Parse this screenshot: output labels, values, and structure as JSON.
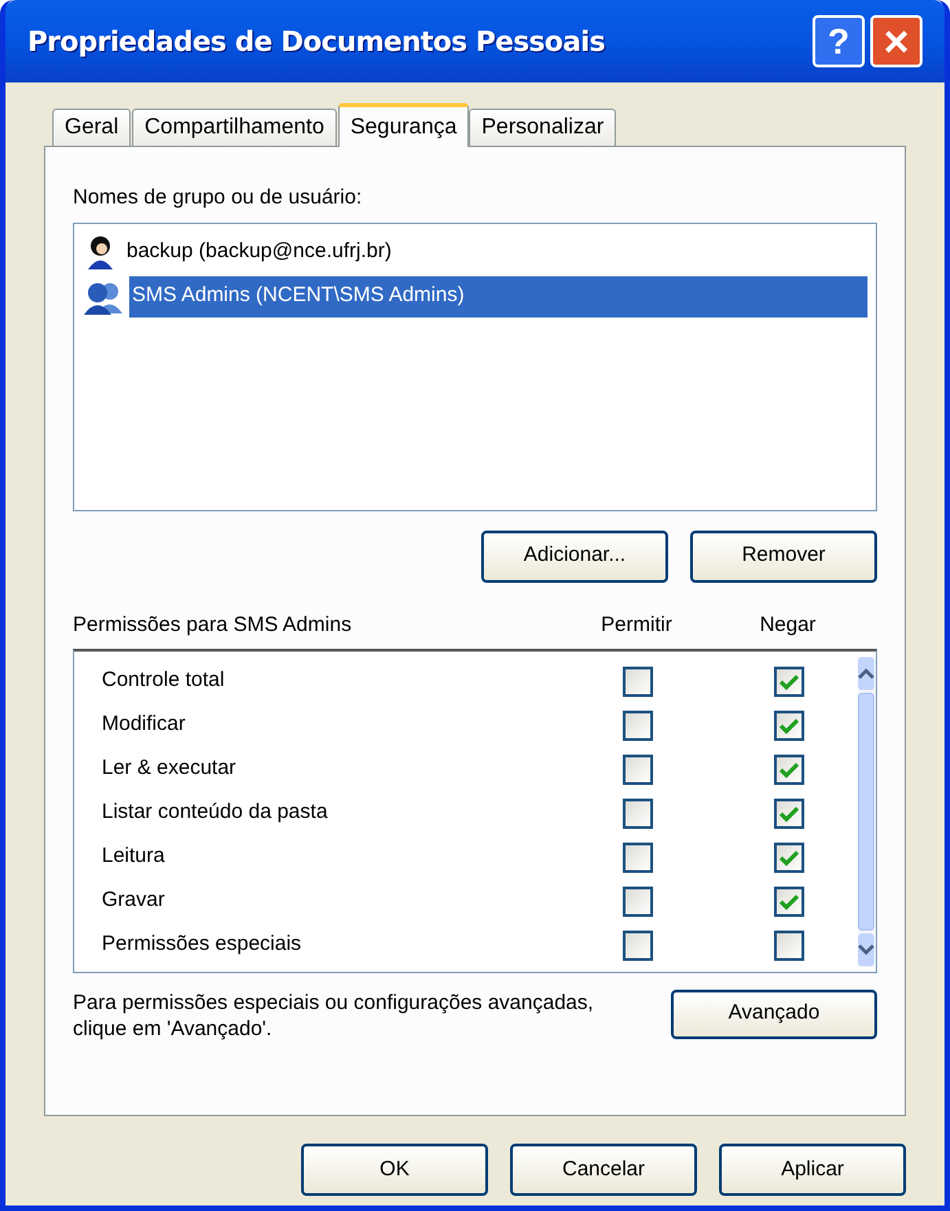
{
  "window": {
    "title": "Propriedades de Documentos Pessoais",
    "help": "?",
    "close": "×"
  },
  "tabs": [
    {
      "label": "Geral",
      "selected": false
    },
    {
      "label": "Compartilhamento",
      "selected": false
    },
    {
      "label": "Segurança",
      "selected": true
    },
    {
      "label": "Personalizar",
      "selected": false
    }
  ],
  "users_label": "Nomes de grupo ou de usuário:",
  "users": [
    {
      "name": "backup (backup@nce.ufrj.br)",
      "kind": "user",
      "selected": false
    },
    {
      "name": "SMS Admins (NCENT\\SMS Admins)",
      "kind": "group",
      "selected": true
    }
  ],
  "user_buttons": [
    "Adicionar...",
    "Remover"
  ],
  "permissions": {
    "title": "Permissões para SMS Admins",
    "allow_label": "Permitir",
    "deny_label": "Negar",
    "rows": [
      {
        "name": "Controle total",
        "allow": false,
        "deny": true
      },
      {
        "name": "Modificar",
        "allow": false,
        "deny": true
      },
      {
        "name": "Ler & executar",
        "allow": false,
        "deny": true
      },
      {
        "name": "Listar conteúdo da pasta",
        "allow": false,
        "deny": true
      },
      {
        "name": "Leitura",
        "allow": false,
        "deny": true
      },
      {
        "name": "Gravar",
        "allow": false,
        "deny": true
      },
      {
        "name": "Permissões especiais",
        "allow": false,
        "deny": false
      }
    ]
  },
  "advanced_note": "Para permissões especiais ou configurações avançadas, clique em 'Avançado'.",
  "advanced_button": "Avançado",
  "buttons": [
    "OK",
    "Cancelar",
    "Aplicar"
  ]
}
